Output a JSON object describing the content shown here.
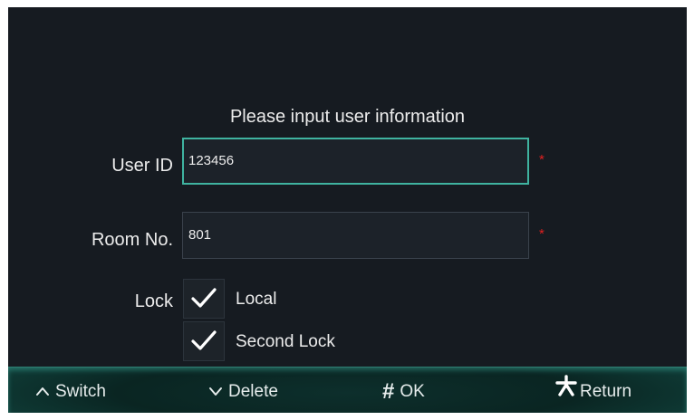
{
  "form": {
    "heading": "Please input user information",
    "user_id": {
      "label": "User ID",
      "value": "123456",
      "required_mark": "*"
    },
    "room_no": {
      "label": "Room No.",
      "value": "801",
      "required_mark": "*"
    },
    "lock": {
      "label": "Lock",
      "options": [
        {
          "label": "Local",
          "checked": true
        },
        {
          "label": "Second Lock",
          "checked": true
        }
      ]
    }
  },
  "bottom_bar": {
    "switch_label": "Switch",
    "delete_label": "Delete",
    "ok_label": "OK",
    "ok_symbol": "#",
    "return_label": "Return"
  },
  "colors": {
    "background": "#161b21",
    "focus_border": "#3fb3a0",
    "required": "#e02020",
    "bar": "#0a2522"
  },
  "icons": [
    "chevron-up-icon",
    "chevron-down-icon",
    "hash-icon",
    "asterisk-icon",
    "checkmark-icon"
  ]
}
